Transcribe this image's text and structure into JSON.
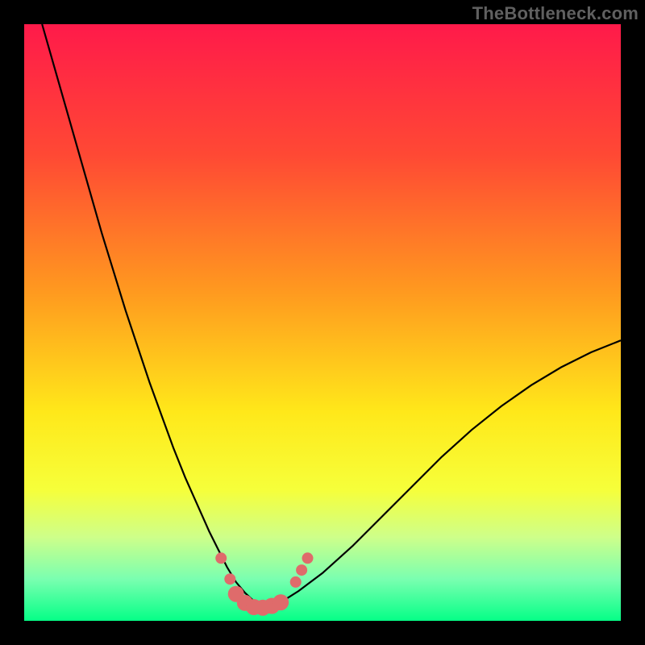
{
  "watermark": "TheBottleneck.com",
  "chart_data": {
    "type": "line",
    "title": "",
    "xlabel": "",
    "ylabel": "",
    "xlim": [
      0,
      100
    ],
    "ylim": [
      0,
      100
    ],
    "background_gradient": {
      "stops": [
        {
          "offset": 0.0,
          "color": "#ff1a4a"
        },
        {
          "offset": 0.22,
          "color": "#ff4934"
        },
        {
          "offset": 0.45,
          "color": "#ff9a1f"
        },
        {
          "offset": 0.65,
          "color": "#ffe81a"
        },
        {
          "offset": 0.78,
          "color": "#f6ff3a"
        },
        {
          "offset": 0.86,
          "color": "#ceff8a"
        },
        {
          "offset": 0.93,
          "color": "#7affb0"
        },
        {
          "offset": 1.0,
          "color": "#05ff87"
        }
      ]
    },
    "series": [
      {
        "name": "curve",
        "color": "#000000",
        "x": [
          3,
          5,
          7,
          9,
          11,
          13,
          15,
          17,
          19,
          21,
          23,
          25,
          27,
          29,
          31,
          32.5,
          34,
          35.5,
          37,
          38.5,
          40,
          43,
          46,
          50,
          55,
          60,
          65,
          70,
          75,
          80,
          85,
          90,
          95,
          100
        ],
        "y": [
          100,
          93,
          86,
          79,
          72,
          65,
          58.5,
          52,
          46,
          40,
          34.5,
          29,
          24,
          19.5,
          15,
          12,
          9,
          6.5,
          4.7,
          3.3,
          2.5,
          3.1,
          5,
          8,
          12.5,
          17.5,
          22.5,
          27.5,
          32,
          36,
          39.5,
          42.5,
          45,
          47
        ]
      }
    ],
    "markers": {
      "name": "highlighted-points",
      "color": "#df6b6b",
      "radius_primary": 10,
      "radius_secondary": 7,
      "points": [
        {
          "x": 33.0,
          "y": 10.5,
          "r": "secondary"
        },
        {
          "x": 34.5,
          "y": 7.0,
          "r": "secondary"
        },
        {
          "x": 35.5,
          "y": 4.5,
          "r": "primary"
        },
        {
          "x": 37.0,
          "y": 3.0,
          "r": "primary"
        },
        {
          "x": 38.5,
          "y": 2.3,
          "r": "primary"
        },
        {
          "x": 40.0,
          "y": 2.2,
          "r": "primary"
        },
        {
          "x": 41.5,
          "y": 2.5,
          "r": "primary"
        },
        {
          "x": 43.0,
          "y": 3.1,
          "r": "primary"
        },
        {
          "x": 45.5,
          "y": 6.5,
          "r": "secondary"
        },
        {
          "x": 46.5,
          "y": 8.5,
          "r": "secondary"
        },
        {
          "x": 47.5,
          "y": 10.5,
          "r": "secondary"
        }
      ]
    }
  }
}
